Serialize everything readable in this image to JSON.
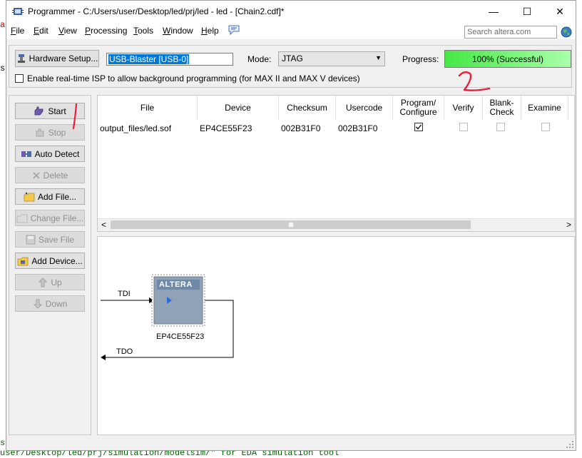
{
  "background": {
    "left_text_1": "a",
    "left_text_2": "ss",
    "bottom_left_text": "s",
    "bottom_console_text": "user/Desktop/led/prj/simulation/modelsim/\" for EDA simulation tool"
  },
  "window": {
    "title": "Programmer - C:/Users/user/Desktop/led/prj/led - led - [Chain2.cdf]*",
    "minimize_glyph": "—",
    "maximize_glyph": "☐",
    "close_glyph": "✕"
  },
  "menu": {
    "items": [
      {
        "accel": "F",
        "rest": "ile"
      },
      {
        "accel": "E",
        "rest": "dit"
      },
      {
        "accel": "V",
        "rest": "iew"
      },
      {
        "accel": "P",
        "rest": "rocessing"
      },
      {
        "accel": "T",
        "rest": "ools"
      },
      {
        "accel": "W",
        "rest": "indow"
      },
      {
        "accel": "H",
        "rest": "elp"
      }
    ],
    "search_placeholder": "Search altera.com"
  },
  "hardware": {
    "setup_button": "Hardware Setup...",
    "current_hardware": "USB-Blaster [USB-0]",
    "mode_label": "Mode:",
    "mode_value": "JTAG",
    "progress_label": "Progress:",
    "progress_text": "100% (Successful)",
    "progress_fraction": 1.0,
    "isp_checkbox_label": "Enable real-time ISP to allow background programming (for MAX II and MAX V devices)",
    "isp_checked": false
  },
  "sidebar": {
    "buttons": [
      {
        "label": "Start",
        "enabled": true
      },
      {
        "label": "Stop",
        "enabled": false
      },
      {
        "label": "Auto Detect",
        "enabled": true
      },
      {
        "label": "Delete",
        "enabled": false
      },
      {
        "label": "Add File...",
        "enabled": true
      },
      {
        "label": "Change File...",
        "enabled": false
      },
      {
        "label": "Save File",
        "enabled": false
      },
      {
        "label": "Add Device...",
        "enabled": true
      },
      {
        "label": "Up",
        "enabled": false
      },
      {
        "label": "Down",
        "enabled": false
      }
    ]
  },
  "table": {
    "headers": {
      "file": "File",
      "device": "Device",
      "checksum": "Checksum",
      "usercode": "Usercode",
      "program_line1": "Program/",
      "program_line2": "Configure",
      "verify": "Verify",
      "blank_line1": "Blank-",
      "blank_line2": "Check",
      "examine": "Examine"
    },
    "rows": [
      {
        "file": "output_files/led.sof",
        "device": "EP4CE55F23",
        "checksum": "002B31F0",
        "usercode": "002B31F0",
        "program": true,
        "verify": false,
        "blank_check": false,
        "examine": false
      }
    ],
    "scroll_left_glyph": "<",
    "scroll_right_glyph": ">"
  },
  "diagram": {
    "tdi_label": "TDI",
    "tdo_label": "TDO",
    "chip_logo": "ALTERA",
    "device_name": "EP4CE55F23"
  },
  "colors": {
    "progress_green": "#45e845",
    "selection_blue": "#0078d7",
    "annotation_red": "#e8203c"
  }
}
